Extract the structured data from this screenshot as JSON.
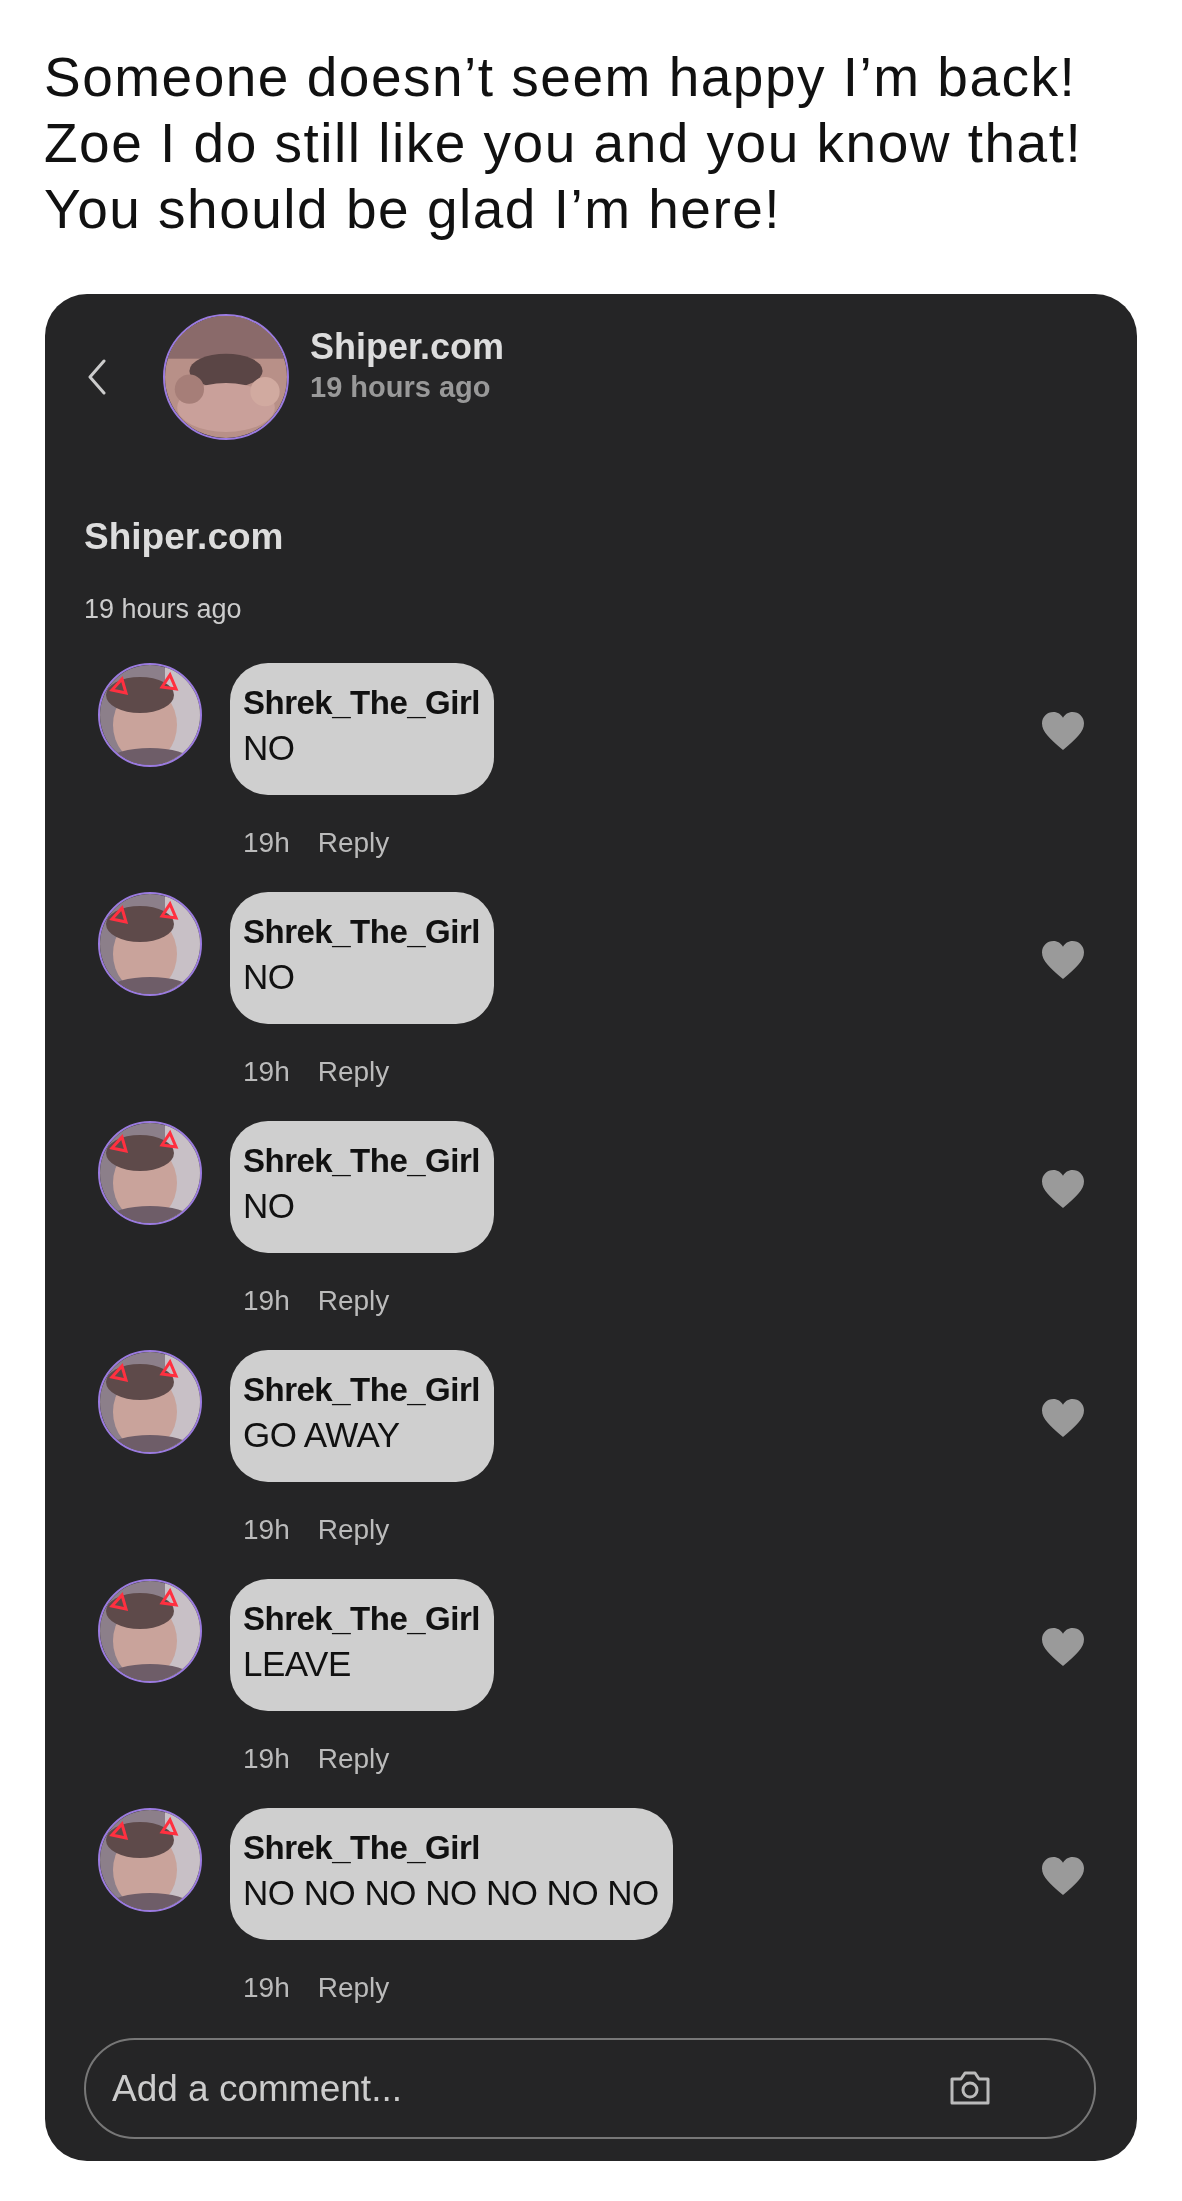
{
  "caption": [
    "Someone doesn’t seem happy I’m back!",
    "Zoe I do still like you and you know that!",
    "You should be glad I’m here!"
  ],
  "header": {
    "name": "Shiper.com",
    "time": "19 hours ago"
  },
  "post": {
    "author": "Shiper.com",
    "time": "19 hours ago"
  },
  "comments": [
    {
      "author": "Shrek_The_Girl",
      "text": "NO",
      "time": "19h",
      "reply": "Reply"
    },
    {
      "author": "Shrek_The_Girl",
      "text": "NO",
      "time": "19h",
      "reply": "Reply"
    },
    {
      "author": "Shrek_The_Girl",
      "text": "NO",
      "time": "19h",
      "reply": "Reply"
    },
    {
      "author": "Shrek_The_Girl",
      "text": "GO AWAY",
      "time": "19h",
      "reply": "Reply"
    },
    {
      "author": "Shrek_The_Girl",
      "text": "LEAVE",
      "time": "19h",
      "reply": "Reply"
    },
    {
      "author": "Shrek_The_Girl",
      "text": "NO NO NO NO NO NO NO",
      "time": "19h",
      "reply": "Reply"
    }
  ],
  "comment_input": {
    "placeholder": "Add a comment..."
  }
}
